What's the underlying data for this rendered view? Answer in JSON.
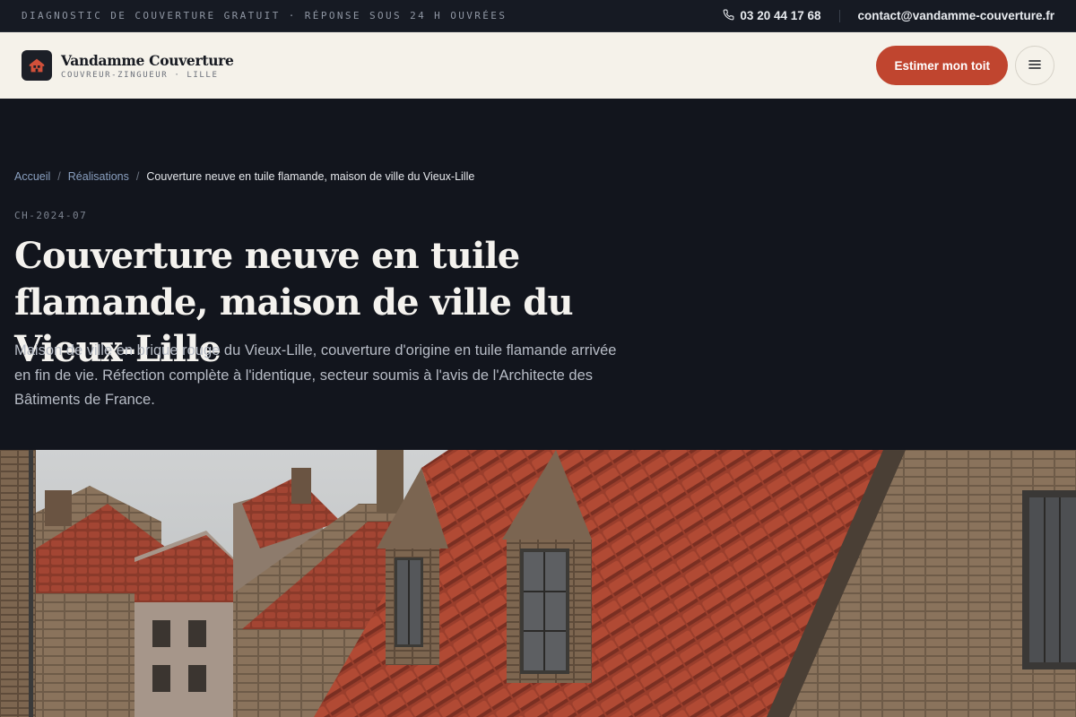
{
  "topbar": {
    "promo": "DIAGNOSTIC DE COUVERTURE GRATUIT · RÉPONSE SOUS 24 H OUVRÉES",
    "phone": "03 20 44 17 68",
    "phone_icon": "phone-icon",
    "email": "contact@vandamme-couverture.fr"
  },
  "header": {
    "brand_name": "Vandamme Couverture",
    "brand_tagline": "COUVREUR-ZINGUEUR · LILLE",
    "logo_icon": "house-icon",
    "cta_label": "Estimer mon toit",
    "menu_icon": "hamburger-menu-icon"
  },
  "breadcrumb": {
    "items": [
      "Accueil",
      "Réalisations"
    ],
    "current": "Couverture neuve en tuile flamande, maison de ville du Vieux-Lille"
  },
  "project": {
    "ref": "CH-2024-07",
    "title": "Couverture neuve en tuile flamande, maison de ville du Vieux-Lille",
    "lead": "Maison de ville en brique rouge du Vieux-Lille, couverture d'origine en tuile flamande arrivée en fin de vie. Réfection complète à l'identique, secteur soumis à l'avis de l'Architecte des Bâtiments de France."
  },
  "colors": {
    "accent": "#c0452f",
    "dark": "#12151d",
    "cream": "#f5f2ea"
  }
}
